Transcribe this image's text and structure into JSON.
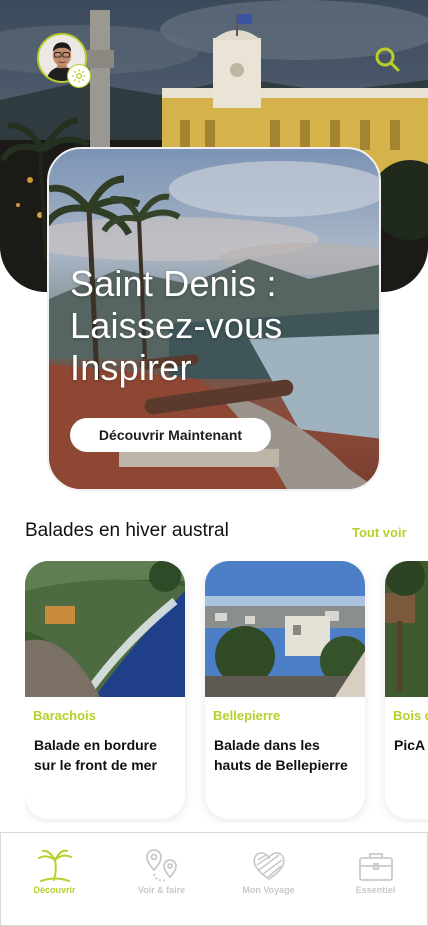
{
  "header": {
    "profile_icon": "user-avatar",
    "settings_icon": "gear-icon",
    "search_icon": "search-icon"
  },
  "featured": {
    "title_line1": "Saint Denis :",
    "title_line2": "Laissez-vous",
    "title_line3": "Inspirer",
    "cta_label": "Découvrir Maintenant"
  },
  "section": {
    "title": "Balades en hiver austral",
    "see_all_label": "Tout voir"
  },
  "cards": [
    {
      "category": "Barachois",
      "title": "Balade en bordure sur le front de mer"
    },
    {
      "category": "Bellepierre",
      "title": "Balade dans les hauts de Bellepierre"
    },
    {
      "category": "Bois de",
      "title": "PicA"
    }
  ],
  "nav": {
    "items": [
      {
        "label": "Découvrir",
        "icon": "palm-tree-icon",
        "active": true
      },
      {
        "label": "Voir & faire",
        "icon": "map-pins-icon",
        "active": false
      },
      {
        "label": "Mon Voyage",
        "icon": "heart-icon",
        "active": false
      },
      {
        "label": "Essentiel",
        "icon": "suitcase-icon",
        "active": false
      }
    ]
  },
  "colors": {
    "accent": "#b8cf2a",
    "nav_inactive": "#c9c9c9",
    "text": "#111111"
  }
}
